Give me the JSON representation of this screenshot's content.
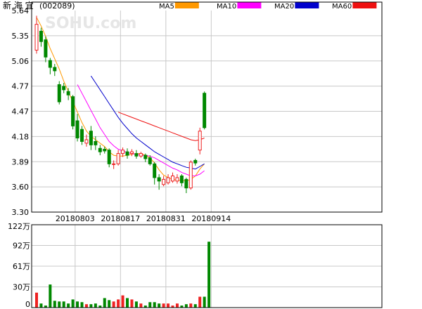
{
  "header": {
    "title": "新 海 宜",
    "code": "(002089)",
    "watermark": "SOHU.com"
  },
  "legend": [
    {
      "label": "MA5",
      "color": "#FF9900"
    },
    {
      "label": "MA10",
      "color": "#FF00FF"
    },
    {
      "label": "MA20",
      "color": "#0000CC"
    },
    {
      "label": "MA60",
      "color": "#EE1111"
    }
  ],
  "colors": {
    "up": "#EE2222",
    "down": "#008800",
    "grid": "#C8C8C8",
    "frame": "#000000"
  },
  "chart_data": [
    {
      "type": "candlestick",
      "y_ticks": [
        "5.64",
        "5.35",
        "5.06",
        "4.77",
        "4.47",
        "4.18",
        "3.89",
        "3.60",
        "3.30"
      ],
      "ylim": [
        3.3,
        5.64
      ],
      "x_tick_labels": [
        {
          "label": "20180803",
          "index": 8
        },
        {
          "label": "20180817",
          "index": 18
        },
        {
          "label": "20180831",
          "index": 28
        },
        {
          "label": "20180914",
          "index": 38
        }
      ],
      "candles": [
        {
          "o": 5.18,
          "c": 5.48,
          "h": 5.58,
          "l": 5.14
        },
        {
          "o": 5.4,
          "c": 5.28,
          "h": 5.44,
          "l": 5.22
        },
        {
          "o": 5.3,
          "c": 5.1,
          "h": 5.34,
          "l": 5.04
        },
        {
          "o": 5.06,
          "c": 4.98,
          "h": 5.09,
          "l": 4.9
        },
        {
          "o": 4.98,
          "c": 4.94,
          "h": 5.02,
          "l": 4.88
        },
        {
          "o": 4.78,
          "c": 4.58,
          "h": 4.82,
          "l": 4.55
        },
        {
          "o": 4.76,
          "c": 4.72,
          "h": 4.8,
          "l": 4.68
        },
        {
          "o": 4.7,
          "c": 4.66,
          "h": 4.74,
          "l": 4.6
        },
        {
          "o": 4.64,
          "c": 4.3,
          "h": 4.66,
          "l": 4.26
        },
        {
          "o": 4.36,
          "c": 4.16,
          "h": 4.44,
          "l": 4.12
        },
        {
          "o": 4.26,
          "c": 4.12,
          "h": 4.3,
          "l": 4.08
        },
        {
          "o": 4.1,
          "c": 4.14,
          "h": 4.2,
          "l": 4.06
        },
        {
          "o": 4.24,
          "c": 4.08,
          "h": 4.3,
          "l": 4.02
        },
        {
          "o": 4.12,
          "c": 4.08,
          "h": 4.18,
          "l": 4.02
        },
        {
          "o": 4.04,
          "c": 4.0,
          "h": 4.08,
          "l": 3.96
        },
        {
          "o": 4.03,
          "c": 4.01,
          "h": 4.06,
          "l": 3.98
        },
        {
          "o": 4.02,
          "c": 3.86,
          "h": 4.04,
          "l": 3.82
        },
        {
          "o": 3.86,
          "c": 3.86,
          "h": 3.9,
          "l": 3.8
        },
        {
          "o": 3.86,
          "c": 3.98,
          "h": 4.02,
          "l": 3.84
        },
        {
          "o": 3.98,
          "c": 4.02,
          "h": 4.05,
          "l": 3.94
        },
        {
          "o": 4.0,
          "c": 3.96,
          "h": 4.04,
          "l": 3.92
        },
        {
          "o": 3.98,
          "c": 4.0,
          "h": 4.03,
          "l": 3.95
        },
        {
          "o": 3.98,
          "c": 3.95,
          "h": 4.02,
          "l": 3.92
        },
        {
          "o": 3.95,
          "c": 3.98,
          "h": 4.0,
          "l": 3.93
        },
        {
          "o": 3.96,
          "c": 3.92,
          "h": 3.98,
          "l": 3.88
        },
        {
          "o": 3.93,
          "c": 3.86,
          "h": 3.96,
          "l": 3.84
        },
        {
          "o": 3.86,
          "c": 3.7,
          "h": 3.88,
          "l": 3.62
        },
        {
          "o": 3.7,
          "c": 3.66,
          "h": 3.74,
          "l": 3.56
        },
        {
          "o": 3.62,
          "c": 3.68,
          "h": 3.72,
          "l": 3.6
        },
        {
          "o": 3.64,
          "c": 3.7,
          "h": 3.74,
          "l": 3.62
        },
        {
          "o": 3.66,
          "c": 3.72,
          "h": 3.76,
          "l": 3.64
        },
        {
          "o": 3.66,
          "c": 3.7,
          "h": 3.74,
          "l": 3.63
        },
        {
          "o": 3.72,
          "c": 3.64,
          "h": 3.74,
          "l": 3.6
        },
        {
          "o": 3.68,
          "c": 3.58,
          "h": 3.7,
          "l": 3.52
        },
        {
          "o": 3.58,
          "c": 3.88,
          "h": 3.9,
          "l": 3.56
        },
        {
          "o": 3.9,
          "c": 3.87,
          "h": 3.92,
          "l": 3.84
        },
        {
          "o": 4.02,
          "c": 4.24,
          "h": 4.28,
          "l": 3.97
        },
        {
          "o": 4.68,
          "c": 4.28,
          "h": 4.7,
          "l": 4.26
        }
      ],
      "ma": {
        "MA5": [
          5.56,
          5.46,
          5.34,
          5.2,
          5.08,
          4.96,
          4.82,
          4.7,
          4.58,
          4.46,
          4.34,
          4.24,
          4.18,
          4.14,
          4.1,
          4.06,
          4.0,
          3.96,
          3.95,
          3.95,
          3.96,
          3.97,
          3.98,
          3.98,
          3.96,
          3.93,
          3.87,
          3.79,
          3.73,
          3.7,
          3.68,
          3.67,
          3.67,
          3.66,
          3.68,
          3.72,
          3.8,
          3.86
        ],
        "MA10": [
          null,
          null,
          null,
          null,
          null,
          null,
          null,
          null,
          null,
          4.78,
          4.68,
          4.58,
          4.48,
          4.38,
          4.28,
          4.2,
          4.12,
          4.07,
          4.03,
          4.01,
          3.99,
          3.98,
          3.97,
          3.96,
          3.96,
          3.95,
          3.93,
          3.9,
          3.87,
          3.84,
          3.81,
          3.79,
          3.76,
          3.74,
          3.72,
          3.72,
          3.74,
          3.78
        ],
        "MA20": [
          null,
          null,
          null,
          null,
          null,
          null,
          null,
          null,
          null,
          null,
          null,
          null,
          4.88,
          4.8,
          4.72,
          4.64,
          4.56,
          4.48,
          4.4,
          4.33,
          4.27,
          4.21,
          4.16,
          4.12,
          4.08,
          4.04,
          4.0,
          3.97,
          3.94,
          3.91,
          3.88,
          3.86,
          3.84,
          3.82,
          3.81,
          3.8,
          3.83,
          3.86
        ],
        "MA60": [
          null,
          null,
          null,
          null,
          null,
          null,
          null,
          null,
          null,
          null,
          null,
          null,
          null,
          null,
          null,
          null,
          null,
          null,
          4.46,
          4.44,
          4.42,
          4.4,
          4.38,
          4.36,
          4.34,
          4.32,
          4.3,
          4.28,
          4.26,
          4.24,
          4.22,
          4.2,
          4.18,
          4.16,
          4.14,
          4.13,
          4.14,
          4.16
        ]
      }
    },
    {
      "type": "bar",
      "y_ticks": [
        "122万",
        "92万",
        "61万",
        "30万",
        "0"
      ],
      "ylim": [
        0,
        122
      ],
      "unit": "万",
      "values": [
        22,
        6,
        3,
        34,
        10,
        9,
        9,
        6,
        12,
        9,
        8,
        5,
        5,
        6,
        3,
        14,
        11,
        9,
        12,
        18,
        14,
        12,
        9,
        6,
        3,
        8,
        8,
        6,
        6,
        6,
        3,
        6,
        3,
        5,
        6,
        5,
        16,
        16,
        97
      ]
    }
  ]
}
